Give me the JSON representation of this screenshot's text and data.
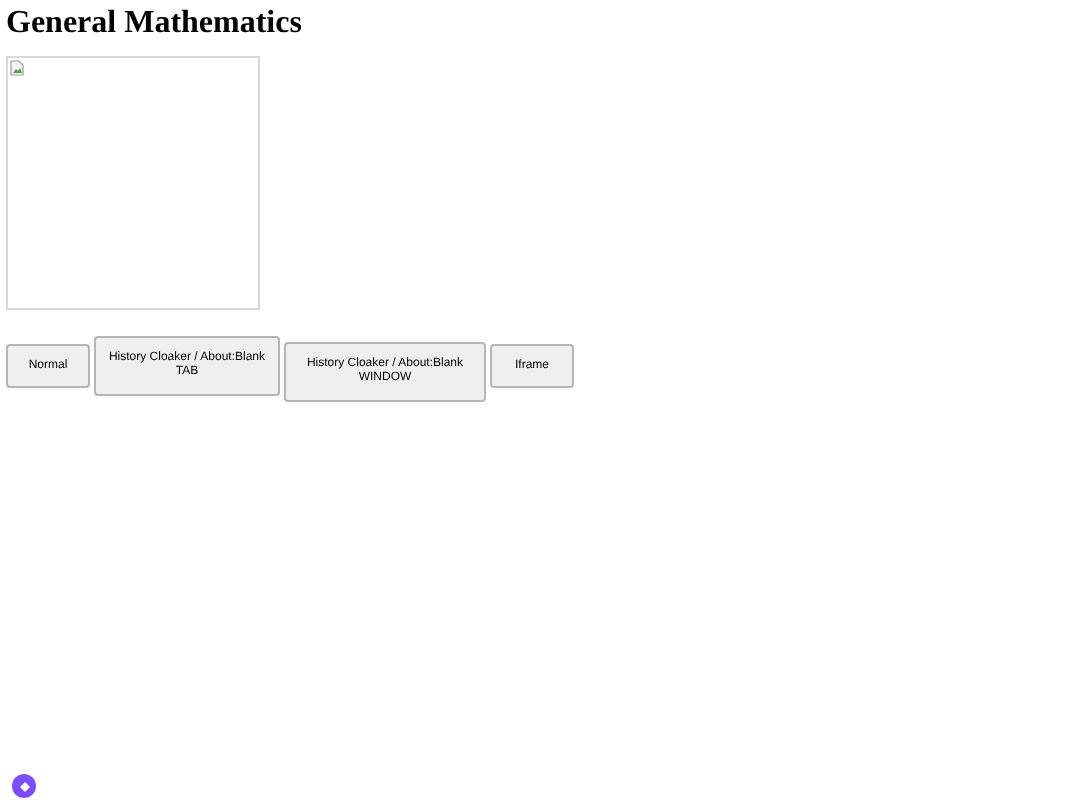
{
  "heading": "General Mathematics",
  "image": {
    "kind": "broken-image"
  },
  "buttons": [
    {
      "label": "Normal"
    },
    {
      "label": "History Cloaker / About:Blank TAB"
    },
    {
      "label": "History Cloaker / About:Blank WINDOW"
    },
    {
      "label": "Iframe"
    }
  ]
}
